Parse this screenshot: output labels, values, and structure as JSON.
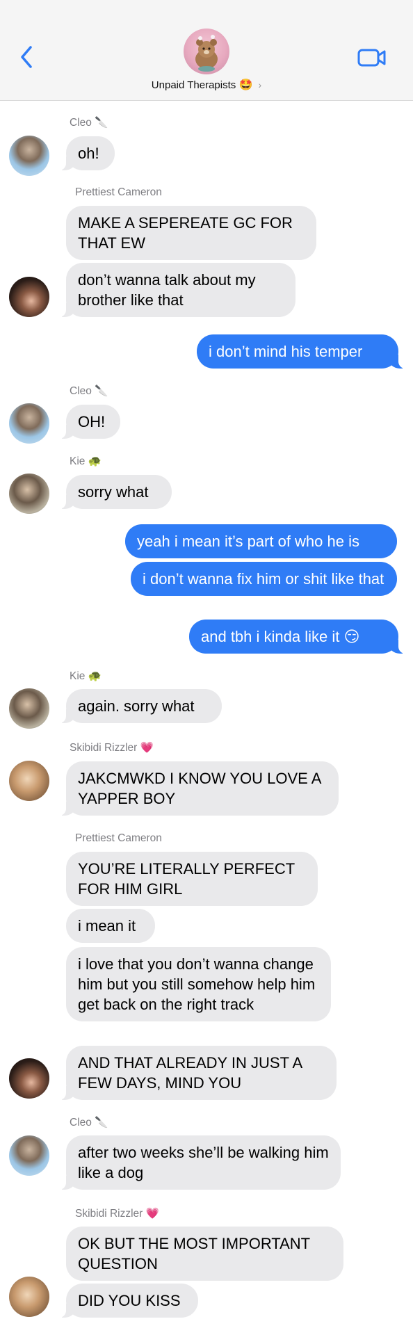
{
  "header": {
    "group_name": "Unpaid Therapists",
    "group_emoji": "🤩",
    "chevron": "›",
    "back_icon": "chevron-left-icon",
    "video_icon": "video-camera-icon",
    "accent_color": "#2f7cf6"
  },
  "colors": {
    "incoming_bubble": "#e9e9eb",
    "outgoing_bubble": "#2f7cf6",
    "sender_label": "#7d7d82"
  },
  "messages": [
    {
      "sender": "Cleo 🔪",
      "text": "oh!"
    },
    {
      "sender": "Prettiest Cameron",
      "text": "MAKE A SEPEREATE GC FOR THAT EW"
    },
    {
      "text": "don’t wanna talk about my brother like that"
    },
    {
      "text": "i don’t mind his temper"
    },
    {
      "sender": "Cleo 🔪",
      "text": "OH!"
    },
    {
      "sender": "Kie 🐢",
      "text": "sorry what"
    },
    {
      "text": "yeah i mean it’s part of who he is"
    },
    {
      "text": "i don’t wanna fix him or shit like that"
    },
    {
      "text": "and tbh i kinda like it 😏"
    },
    {
      "sender": "Kie 🐢",
      "text": "again. sorry what"
    },
    {
      "sender": "Skibidi Rizzler 💗",
      "text": "JAKCMWKD I KNOW YOU LOVE A YAPPER BOY"
    },
    {
      "sender": "Prettiest Cameron",
      "text": "YOU’RE LITERALLY PERFECT FOR HIM GIRL"
    },
    {
      "text": "i mean it"
    },
    {
      "text": "i love that you don’t wanna change him but you still somehow help him get back on the right track"
    },
    {
      "text": "AND THAT ALREADY IN JUST A FEW DAYS, MIND YOU"
    },
    {
      "sender": "Cleo 🔪",
      "text": "after two weeks she’ll be walking him like a dog"
    },
    {
      "sender": "Skibidi Rizzler 💗",
      "text": "OK BUT THE MOST IMPORTANT QUESTION"
    },
    {
      "text": "DID YOU KISS"
    }
  ]
}
